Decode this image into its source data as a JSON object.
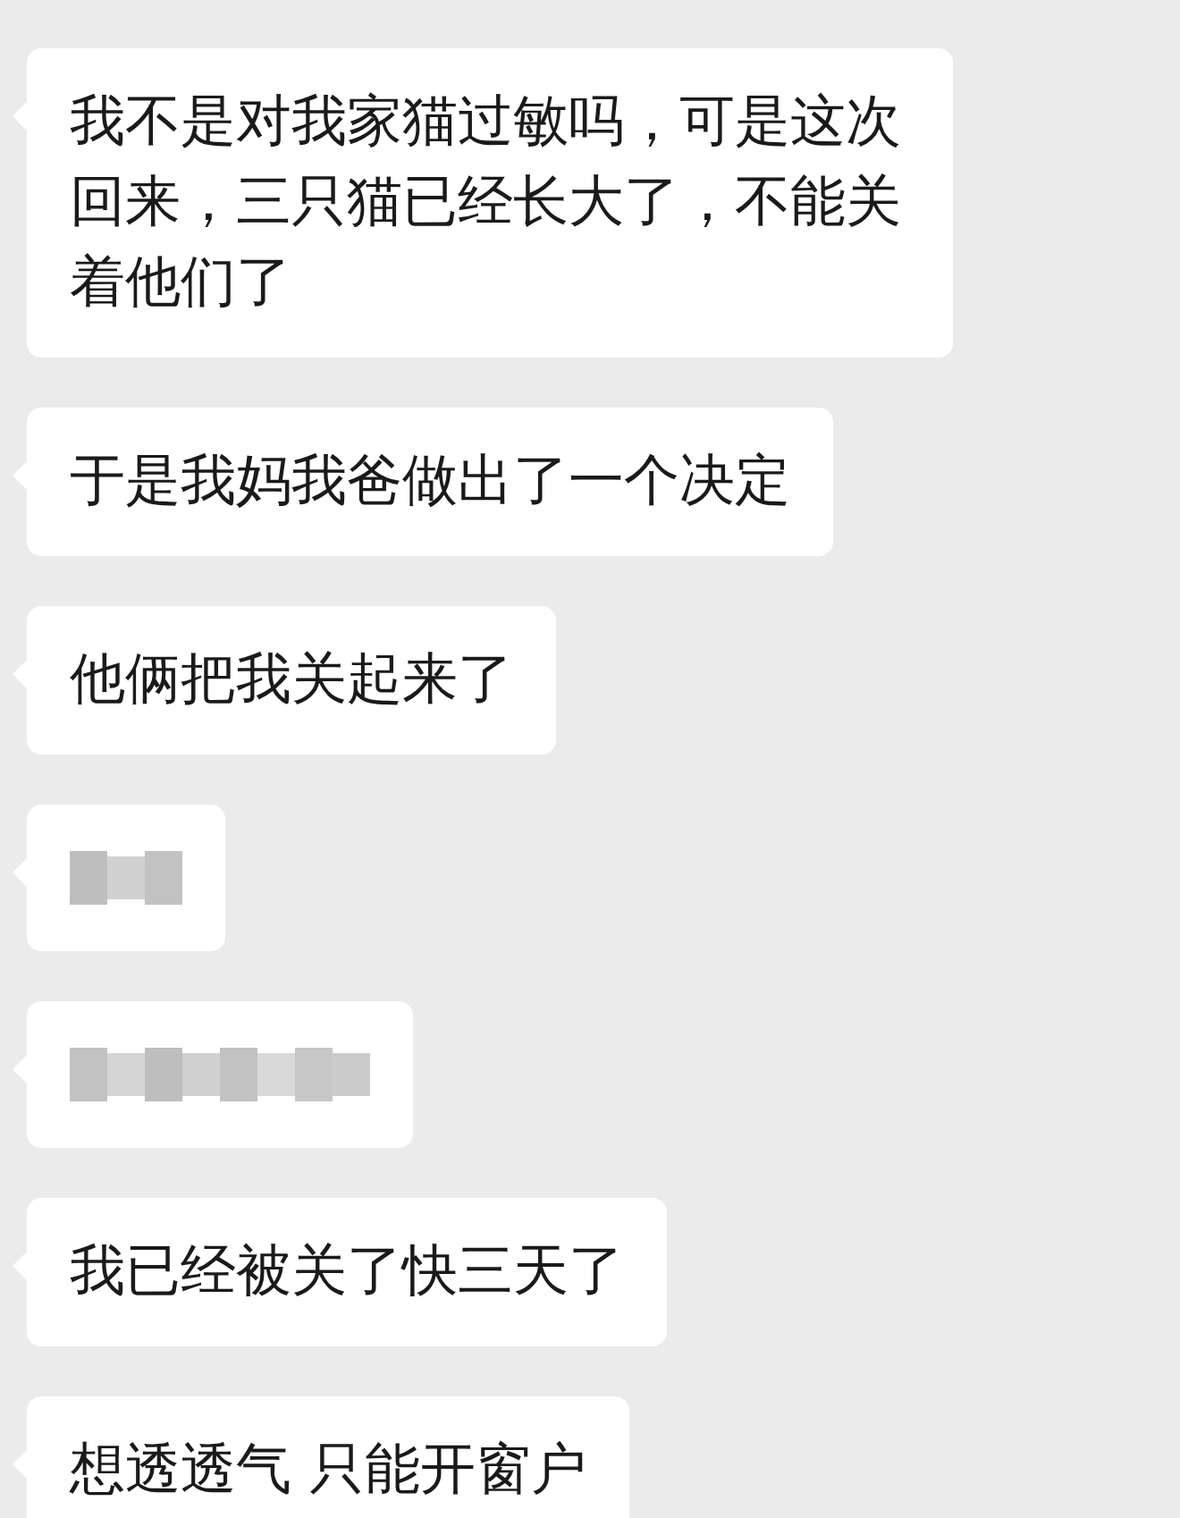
{
  "messages": [
    {
      "kind": "text",
      "text": "我不是对我家猫过敏吗，可是这次回来，三只猫已经长大了，不能关着他们了"
    },
    {
      "kind": "text",
      "text": "于是我妈我爸做出了一个决定"
    },
    {
      "kind": "text",
      "text": "他俩把我关起来了"
    },
    {
      "kind": "redacted-short"
    },
    {
      "kind": "redacted-long"
    },
    {
      "kind": "text",
      "text": "我已经被关了快三天了"
    },
    {
      "kind": "text",
      "text": "想透透气 只能开窗户"
    }
  ]
}
